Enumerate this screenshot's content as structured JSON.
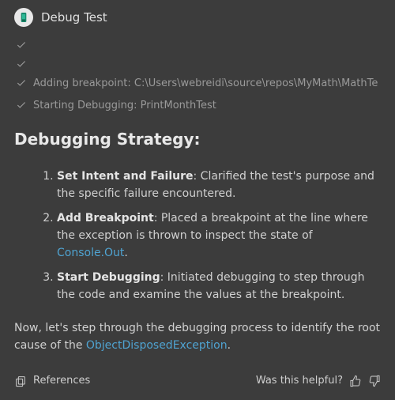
{
  "header": {
    "title": "Debug Test"
  },
  "progress": {
    "items": [
      "",
      "",
      "Adding breakpoint: C:\\Users\\webreidi\\source\\repos\\MyMath\\MathTe",
      "Starting Debugging: PrintMonthTest"
    ]
  },
  "strategy": {
    "heading": "Debugging Strategy:",
    "steps": [
      {
        "title": "Set Intent and Failure",
        "body_before": ": Clarified the test's purpose and the specific failure encountered.",
        "link": "",
        "body_after": ""
      },
      {
        "title": "Add Breakpoint",
        "body_before": ": Placed a breakpoint at the line where the exception is thrown to inspect the state of ",
        "link": "Console.Out",
        "body_after": "."
      },
      {
        "title": "Start Debugging",
        "body_before": ": Initiated debugging to step through the code and examine the values at the breakpoint.",
        "link": "",
        "body_after": ""
      }
    ]
  },
  "summary": {
    "before": "Now, let's step through the debugging process to identify the root cause of the ",
    "link": "ObjectDisposedException",
    "after": "."
  },
  "footer": {
    "references_label": "References",
    "helpful_label": "Was this helpful?"
  },
  "colors": {
    "link": "#4fa3d1",
    "bg": "#3c3c3c"
  }
}
